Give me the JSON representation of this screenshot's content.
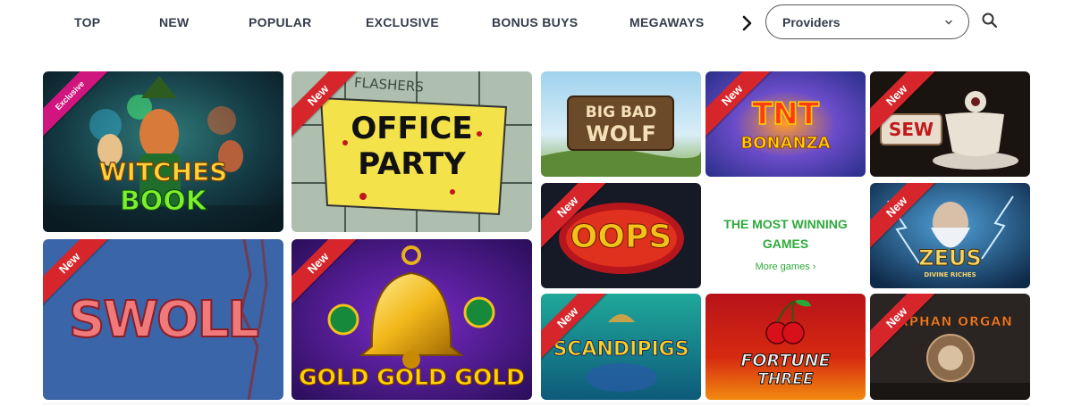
{
  "nav": {
    "items": [
      "TOP",
      "NEW",
      "POPULAR",
      "EXCLUSIVE",
      "BONUS BUYS",
      "MEGAWAYS"
    ],
    "providers_label": "Providers"
  },
  "icons": {
    "next": "chevron-right-icon",
    "dropdown": "chevron-down-icon",
    "search": "search-icon"
  },
  "badges": {
    "new": "New",
    "exclusive": "Exclusive"
  },
  "games": {
    "witches_book": {
      "title_line1": "WITCHES",
      "title_line2": "BOOK",
      "badge": "Exclusive"
    },
    "office_party": {
      "title_line1": "OFFICE",
      "title_line2": "PARTY",
      "sign_top": "FLASHERS",
      "badge": "New"
    },
    "big_bad_wolf": {
      "title_line1": "BIG BAD",
      "title_line2": "WOLF"
    },
    "tnt_bonanza": {
      "title_line1": "TNT",
      "title_line2": "BONANZA",
      "badge": "New"
    },
    "sew": {
      "title": "SEW",
      "badge": "New"
    },
    "oops": {
      "title": "OOPS",
      "badge": "New"
    },
    "zeus": {
      "title": "ZEUS",
      "subtitle": "DIVINE RICHES",
      "badge": "New"
    },
    "swoll": {
      "title": "SWOLL",
      "badge": "New"
    },
    "gold_gold_gold": {
      "title": "GOLD GOLD GOLD",
      "badge": "New"
    },
    "scandipigs": {
      "title": "SCANDIPIGS",
      "badge": "New"
    },
    "fortune_three": {
      "title_line1": "FORTUNE",
      "title_line2": "THREE"
    },
    "orphan_organ": {
      "title": "ORPHAN ORGAN",
      "badge": "New"
    }
  },
  "promo": {
    "title_line1": "THE MOST WINNING",
    "title_line2": "GAMES",
    "link": "More games ›"
  },
  "colors": {
    "accent_green": "#2eaa3c",
    "ribbon_new": "#d7262b",
    "ribbon_exclusive": "#d0157f",
    "nav_text": "#333c4a"
  }
}
